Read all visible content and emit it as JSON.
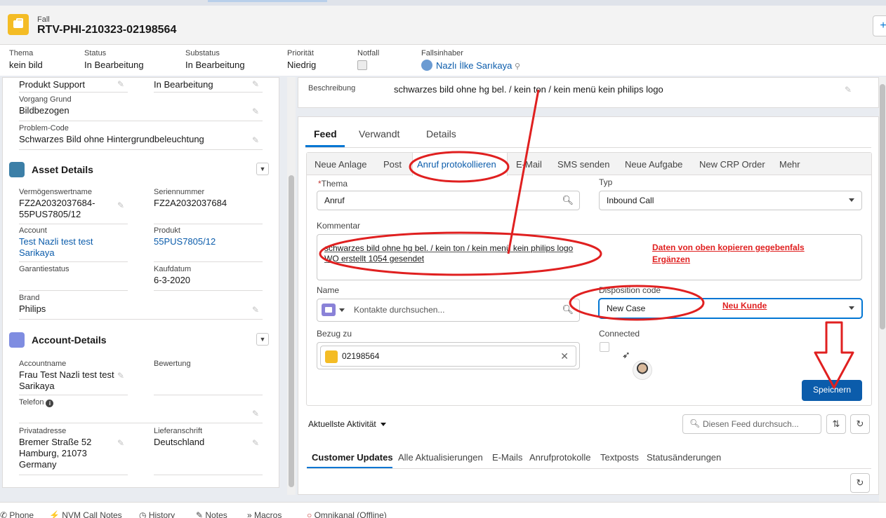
{
  "header": {
    "object_label": "Fall",
    "case_number": "RTV-PHI-210323-02198564"
  },
  "highlights": [
    {
      "label": "Thema",
      "value": "kein bild"
    },
    {
      "label": "Status",
      "value": "In Bearbeitung"
    },
    {
      "label": "Substatus",
      "value": "In Bearbeitung"
    },
    {
      "label": "Priorität",
      "value": "Niedrig"
    },
    {
      "label": "Notfall",
      "value": ""
    },
    {
      "label": "Fallsinhaber",
      "value": "Nazlı İlke Sarıkaya"
    }
  ],
  "left_panel": {
    "top_fields": {
      "produkt_support": "Produkt Support",
      "in_bearbeitung": "In Bearbeitung",
      "vorgang_grund_label": "Vorgang Grund",
      "vorgang_grund": "Bildbezogen",
      "problem_code_label": "Problem-Code",
      "problem_code": "Schwarzes Bild ohne Hintergrundbeleuchtung"
    },
    "asset": {
      "title": "Asset Details",
      "vermoegen_label": "Vermögenswertname",
      "vermoegen_line1": "FZ2A2032037684-",
      "vermoegen_line2": "55PUS7805/12",
      "serien_label": "Seriennummer",
      "serien": "FZ2A2032037684",
      "account_label": "Account",
      "account_line1": "Test Nazli test test",
      "account_line2": "Sarikaya",
      "produkt_label": "Produkt",
      "produkt": "55PUS7805/12",
      "garantie_label": "Garantiestatus",
      "kaufdatum_label": "Kaufdatum",
      "kaufdatum": "6-3-2020",
      "brand_label": "Brand",
      "brand": "Philips"
    },
    "account": {
      "title": "Account-Details",
      "name_label": "Accountname",
      "name_line1": "Frau Test Nazli test test",
      "name_line2": "Sarikaya",
      "bewertung_label": "Bewertung",
      "telefon_label": "Telefon",
      "privat_label": "Privatadresse",
      "privat_line1": "Bremer Straße 52",
      "privat_line2": "Hamburg, 21073",
      "privat_line3": "Germany",
      "liefer_label": "Lieferanschrift",
      "liefer": "Deutschland"
    }
  },
  "description": {
    "label": "Beschreibung",
    "value": "schwarzes bild ohne hg bel. / kein ton / kein menü kein philips logo"
  },
  "feed_tabs": [
    "Feed",
    "Verwandt",
    "Details"
  ],
  "publisher_tabs": [
    "Neue Anlage",
    "Post",
    "Anruf protokollieren",
    "E-Mail",
    "SMS senden",
    "Neue Aufgabe",
    "New CRP Order",
    "Mehr"
  ],
  "form": {
    "thema_label": "Thema",
    "thema_value": "Anruf",
    "typ_label": "Typ",
    "typ_value": "Inbound Call",
    "kommentar_label": "Kommentar",
    "kommentar_line1": "schwarzes bild ohne hg bel. / kein ton / kein menü kein philips logo",
    "kommentar_line2": "WO erstellt 1054 gesendet",
    "name_label": "Name",
    "name_placeholder": "Kontakte durchsuchen...",
    "disposition_label": "Disposition code",
    "disposition_value": "New Case",
    "bezug_label": "Bezug zu",
    "bezug_value": "02198564",
    "connected_label": "Connected",
    "save_label": "Speichern"
  },
  "annotations": {
    "note1_line1": "Daten von oben kopieren gegebenfals",
    "note1_line2": "Ergänzen",
    "note2": "Neu Kunde"
  },
  "activity": {
    "label": "Aktuellste Aktivität",
    "search_placeholder": "Diesen Feed durchsuch..."
  },
  "filter_tabs": [
    "Customer Updates",
    "Alle Aktualisierungen",
    "E-Mails",
    "Anrufprotokolle",
    "Textposts",
    "Statusänderungen"
  ],
  "utility_bar": [
    "Phone",
    "NVM Call Notes",
    "History",
    "Notes",
    "Macros",
    "Omnikanal (Offline)"
  ],
  "colors": {
    "brand_blue": "#0176d3",
    "annotation_red": "#e02020",
    "case_icon": "#f4bc25"
  }
}
